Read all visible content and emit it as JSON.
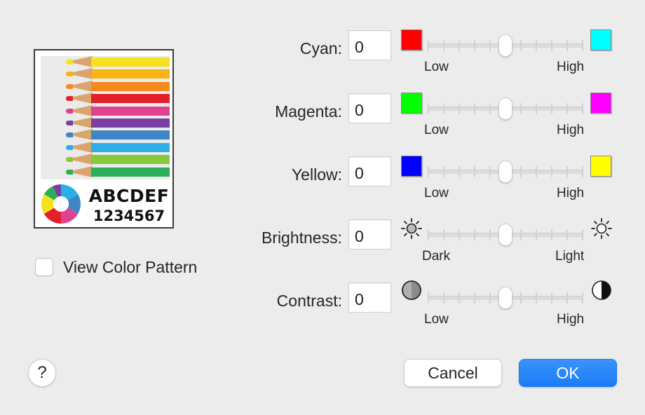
{
  "preview": {
    "sample_letters": "ABCDEF",
    "sample_digits": "1234567",
    "pencil_colors": [
      "#f6e11e",
      "#f7b414",
      "#f58a1f",
      "#e2202a",
      "#e0428e",
      "#7a3fa3",
      "#3f86c8",
      "#2ab0e6",
      "#86c93a",
      "#2bb05a"
    ]
  },
  "view_color_pattern": {
    "label": "View Color Pattern",
    "checked": false
  },
  "rows": [
    {
      "label": "Cyan:",
      "value": "0",
      "low": "Low",
      "high": "High",
      "low_color": "#ff0000",
      "high_color": "#00ffff",
      "level": 0.5
    },
    {
      "label": "Magenta:",
      "value": "0",
      "low": "Low",
      "high": "High",
      "low_color": "#00ff00",
      "high_color": "#ff00ff",
      "level": 0.5
    },
    {
      "label": "Yellow:",
      "value": "0",
      "low": "Low",
      "high": "High",
      "low_color": "#0000ff",
      "high_color": "#ffff00",
      "level": 0.5
    },
    {
      "label": "Brightness:",
      "value": "0",
      "low": "Dark",
      "high": "Light",
      "low_icon": "sun-dim-icon",
      "high_icon": "sun-bright-icon",
      "level": 0.5
    },
    {
      "label": "Contrast:",
      "value": "0",
      "low": "Low",
      "high": "High",
      "low_icon": "contrast-low-icon",
      "high_icon": "contrast-high-icon",
      "level": 0.5
    }
  ],
  "buttons": {
    "help": "?",
    "cancel": "Cancel",
    "ok": "OK"
  },
  "colors": {
    "accent": "#1a7cf5",
    "dialog_bg": "#ececec"
  }
}
